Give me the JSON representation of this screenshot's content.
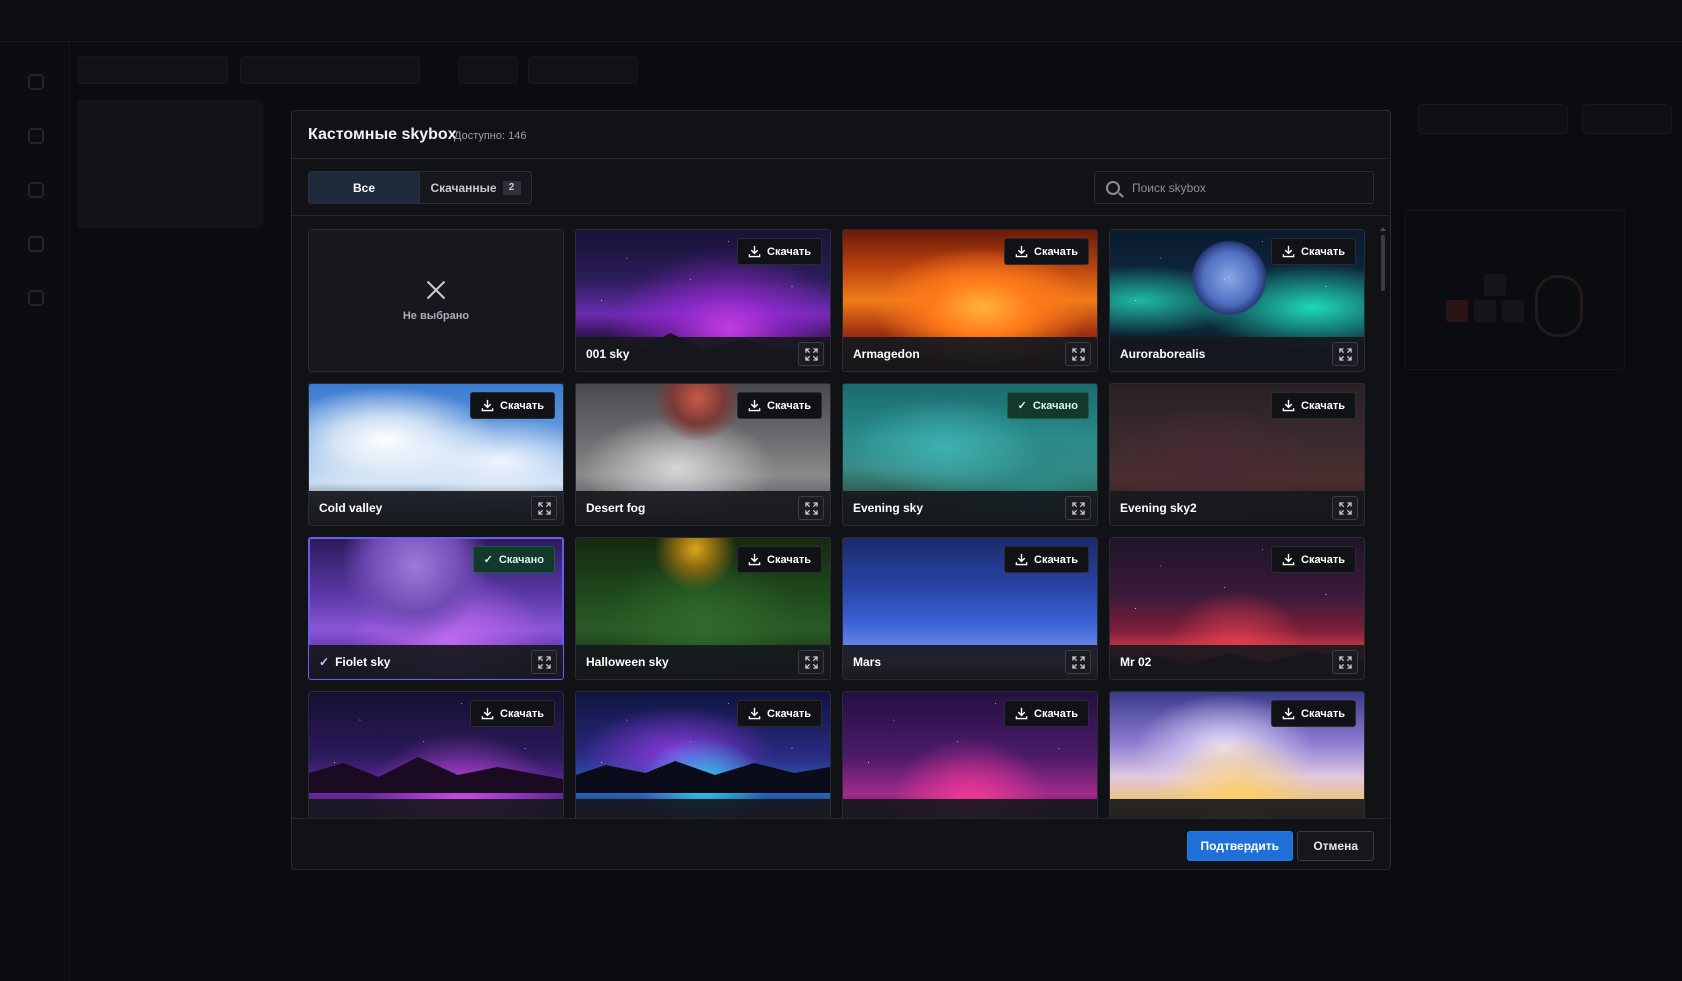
{
  "modal": {
    "title": "Кастомные skybox",
    "subtitle": "Доступно: 146",
    "filters": {
      "all_label": "Все",
      "downloaded_label": "Скачанные",
      "downloaded_count": "2"
    },
    "search": {
      "placeholder": "Поиск skybox"
    },
    "none_label": "Не выбрано",
    "download_label": "Скачать",
    "downloaded_label": "Скачано",
    "items": [
      {
        "name": "001 sky",
        "state": "available"
      },
      {
        "name": "Armagedon",
        "state": "available"
      },
      {
        "name": "Auroraborealis",
        "state": "available"
      },
      {
        "name": "Cold valley",
        "state": "available"
      },
      {
        "name": "Desert fog",
        "state": "available"
      },
      {
        "name": "Evening sky",
        "state": "downloaded"
      },
      {
        "name": "Evening sky2",
        "state": "available"
      },
      {
        "name": "Fiolet sky",
        "state": "downloaded",
        "selected": true
      },
      {
        "name": "Halloween sky",
        "state": "available"
      },
      {
        "name": "Mars",
        "state": "available"
      },
      {
        "name": "Mr 02",
        "state": "available"
      },
      {
        "name": "",
        "state": "available"
      },
      {
        "name": "",
        "state": "available"
      },
      {
        "name": "",
        "state": "available"
      },
      {
        "name": "",
        "state": "available"
      }
    ],
    "confirm_label": "Подтвердить",
    "cancel_label": "Отмена"
  },
  "colors": {
    "accent_blue": "#1f6fd9",
    "selected_border": "#6b5cf0",
    "downloaded_badge": "#13382c"
  }
}
